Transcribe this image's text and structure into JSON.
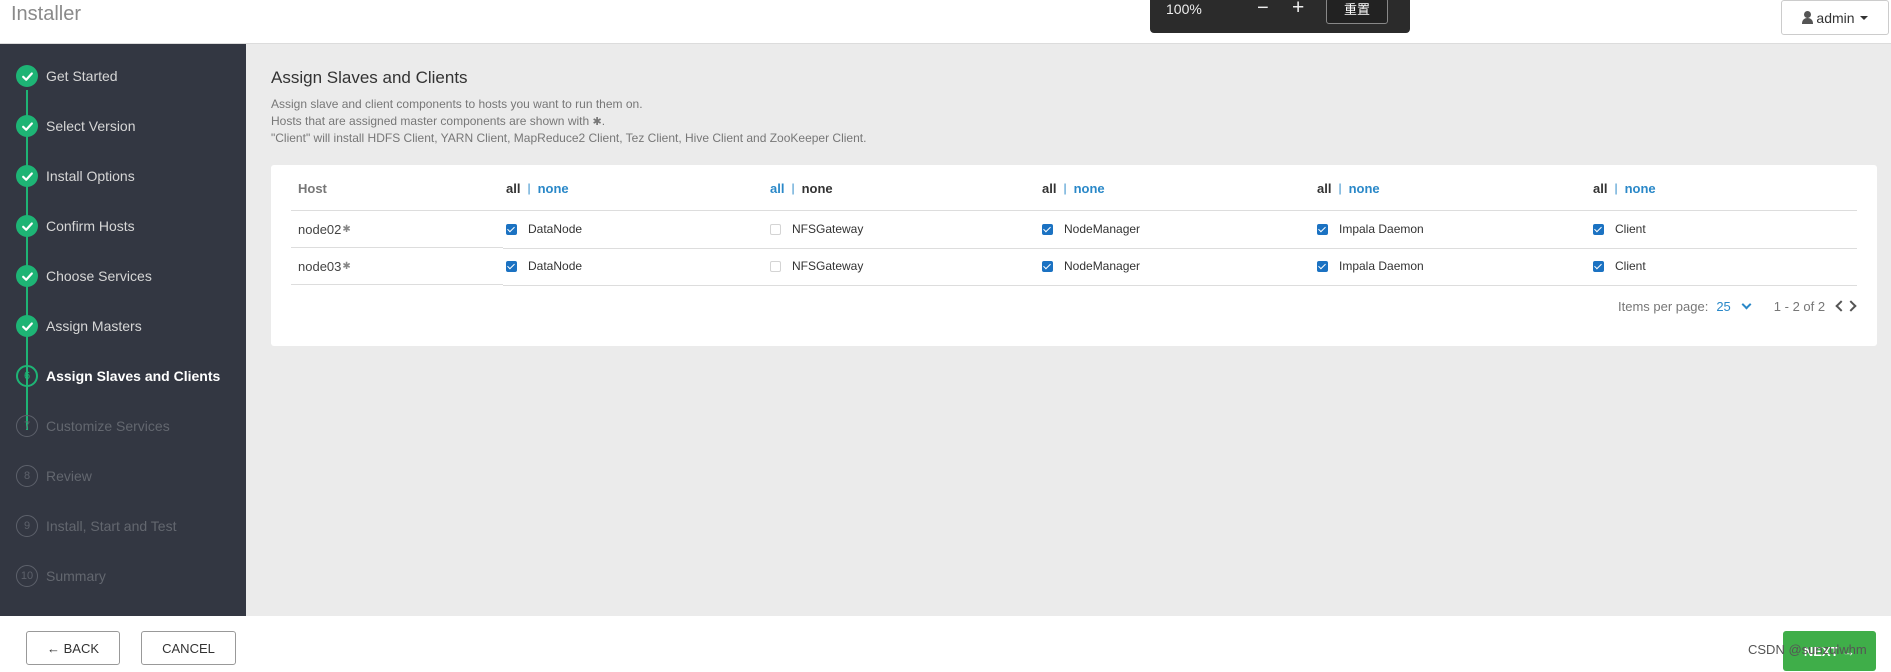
{
  "app": {
    "title": "Installer"
  },
  "zoom": {
    "level": "100%",
    "minus": "−",
    "plus": "+",
    "reset": "重置"
  },
  "user": {
    "name": "admin"
  },
  "sidebar": {
    "steps": [
      {
        "label": "Get Started",
        "state": "done"
      },
      {
        "label": "Select Version",
        "state": "done"
      },
      {
        "label": "Install Options",
        "state": "done"
      },
      {
        "label": "Confirm Hosts",
        "state": "done"
      },
      {
        "label": "Choose Services",
        "state": "done"
      },
      {
        "label": "Assign Masters",
        "state": "done"
      },
      {
        "label": "Assign Slaves and Clients",
        "state": "current",
        "num": "6"
      },
      {
        "label": "Customize Services",
        "state": "todo",
        "num": "7"
      },
      {
        "label": "Review",
        "state": "todo",
        "num": "8"
      },
      {
        "label": "Install, Start and Test",
        "state": "todo",
        "num": "9"
      },
      {
        "label": "Summary",
        "state": "todo",
        "num": "10"
      }
    ]
  },
  "main": {
    "title": "Assign Slaves and Clients",
    "desc1": "Assign slave and client components to hosts you want to run them on.",
    "desc2": "Hosts that are assigned master components are shown with",
    "desc2_marker": "✱",
    "desc2_end": ".",
    "desc3": "\"Client\" will install HDFS Client, YARN Client, MapReduce2 Client, Tez Client, Hive Client and ZooKeeper Client."
  },
  "table": {
    "host_header": "Host",
    "all_label": "all",
    "sep": "|",
    "none_label": "none",
    "host_marker": "✱",
    "rows": [
      {
        "host": "node02",
        "cells": [
          {
            "label": "DataNode",
            "checked": true
          },
          {
            "label": "NFSGateway",
            "checked": false
          },
          {
            "label": "NodeManager",
            "checked": true
          },
          {
            "label": "Impala Daemon",
            "checked": true
          },
          {
            "label": "Client",
            "checked": true
          }
        ]
      },
      {
        "host": "node03",
        "cells": [
          {
            "label": "DataNode",
            "checked": true
          },
          {
            "label": "NFSGateway",
            "checked": false
          },
          {
            "label": "NodeManager",
            "checked": true
          },
          {
            "label": "Impala Daemon",
            "checked": true
          },
          {
            "label": "Client",
            "checked": true
          }
        ]
      }
    ]
  },
  "pager": {
    "items_per_page_label": "Items per page:",
    "per_page": "25",
    "range": "1 - 2 of 2"
  },
  "footer": {
    "back": "← BACK",
    "cancel": "CANCEL",
    "next": "NEXT →",
    "watermark": "CSDN @sunzulwhm"
  },
  "colors": {
    "accent_green": "#1eb475",
    "link_blue": "#2a88c8",
    "sidebar_bg": "#333742",
    "next_green": "#3fae49"
  }
}
